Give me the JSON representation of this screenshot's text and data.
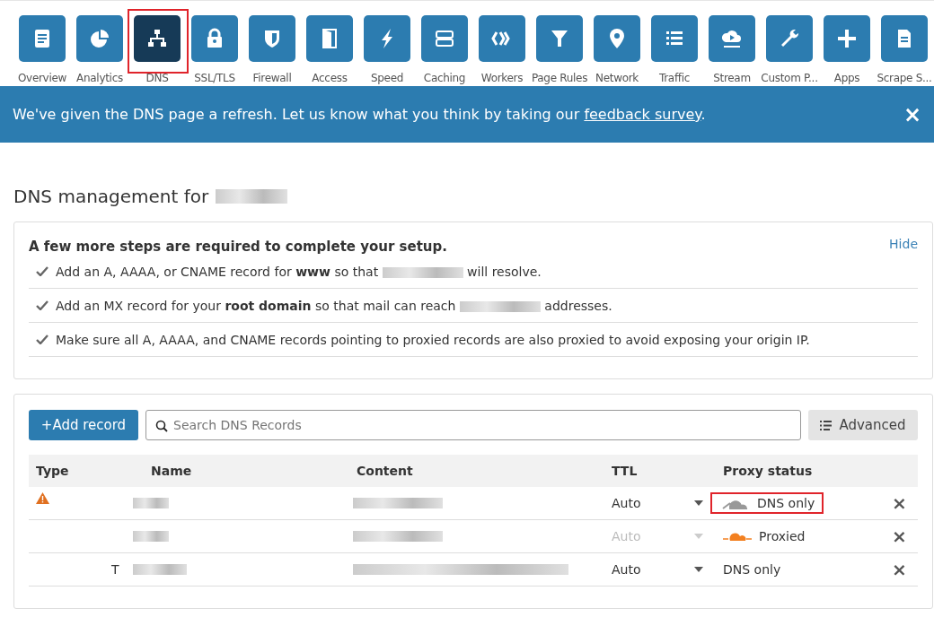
{
  "nav": {
    "tabs": [
      {
        "label": "Overview",
        "selected": false
      },
      {
        "label": "Analytics",
        "selected": false
      },
      {
        "label": "DNS",
        "selected": true,
        "highlighted": true
      },
      {
        "label": "SSL/TLS",
        "selected": false
      },
      {
        "label": "Firewall",
        "selected": false
      },
      {
        "label": "Access",
        "selected": false
      },
      {
        "label": "Speed",
        "selected": false
      },
      {
        "label": "Caching",
        "selected": false
      },
      {
        "label": "Workers",
        "selected": false
      },
      {
        "label": "Page Rules",
        "selected": false
      },
      {
        "label": "Network",
        "selected": false
      },
      {
        "label": "Traffic",
        "selected": false
      },
      {
        "label": "Stream",
        "selected": false
      },
      {
        "label": "Custom P...",
        "selected": false
      },
      {
        "label": "Apps",
        "selected": false
      },
      {
        "label": "Scrape S...",
        "selected": false
      }
    ]
  },
  "banner": {
    "text": "We've given the DNS page a refresh. Let us know what you think by taking our",
    "link": "feedback survey",
    "end": ".",
    "close": "×"
  },
  "heading": "DNS management for",
  "setup": {
    "title": "A few more steps are required to complete your setup.",
    "hide": "Hide",
    "steps": [
      {
        "before": "Add an A, AAAA, or CNAME record for **www** so that",
        "after": "will resolve."
      },
      {
        "before": "Add an MX record for your **root domain** so that mail can reach",
        "after": "addresses."
      },
      {
        "before": "Make sure all A, AAAA, and CNAME records pointing to proxied records are also proxied to avoid exposing your origin IP."
      }
    ]
  },
  "records": {
    "add_button": "+Add record",
    "search": {
      "placeholder": "Search DNS Records"
    },
    "advanced": "Advanced",
    "columns": [
      "Type",
      "Name",
      "Content",
      "TTL",
      "Proxy status"
    ],
    "rows": [
      {
        "warning": true,
        "type": "",
        "ttl": "Auto",
        "ttl_disabled": false,
        "proxy": {
          "kind": "dns_only",
          "label": "DNS only",
          "highlighted": true
        }
      },
      {
        "warning": false,
        "type": "",
        "ttl": "Auto",
        "ttl_disabled": true,
        "proxy": {
          "kind": "proxied",
          "label": "Proxied",
          "highlighted": false
        }
      },
      {
        "warning": false,
        "type": "T",
        "ttl": "Auto",
        "ttl_disabled": false,
        "proxy": {
          "kind": "text",
          "label": "DNS only",
          "highlighted": false
        }
      }
    ],
    "delete": "×"
  }
}
